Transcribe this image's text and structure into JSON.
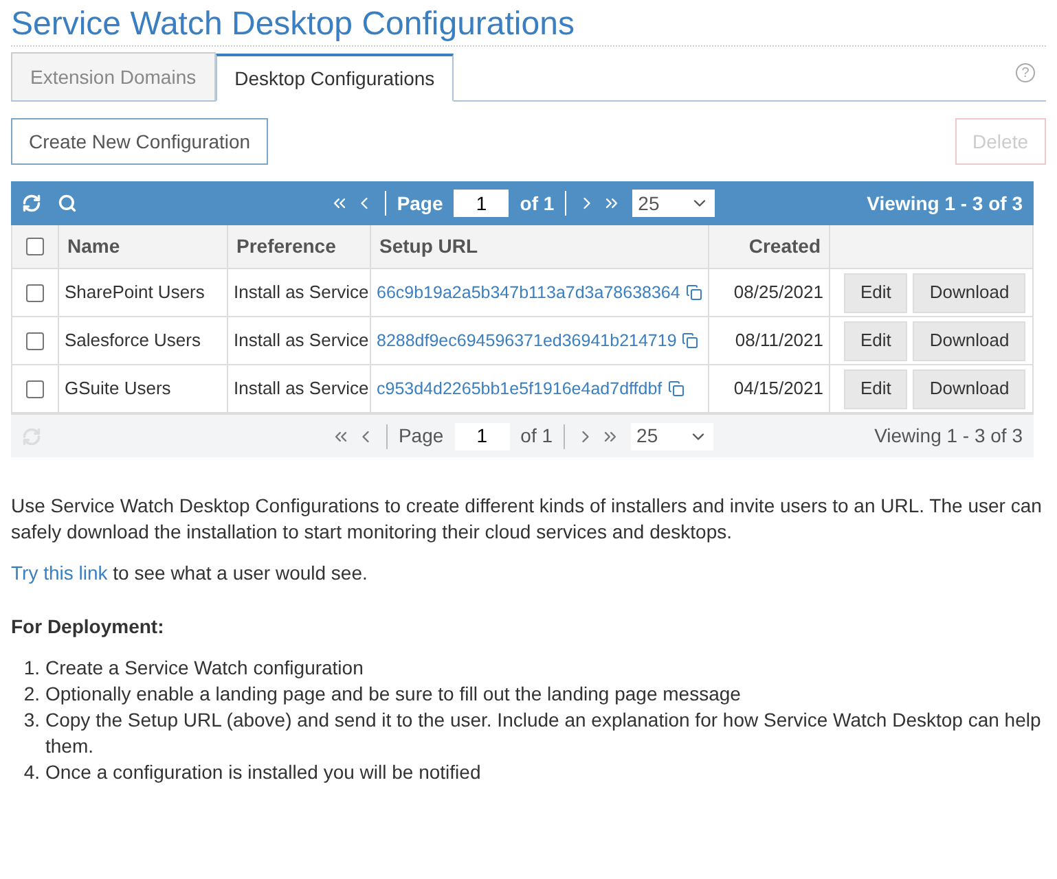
{
  "title": "Service Watch Desktop Configurations",
  "tabs": [
    {
      "label": "Extension Domains",
      "selected": false
    },
    {
      "label": "Desktop Configurations",
      "selected": true
    }
  ],
  "help_icon": "?",
  "buttons": {
    "create": {
      "label": "Create New Configuration",
      "disabled": false
    },
    "delete": {
      "label": "Delete",
      "disabled": true
    }
  },
  "pager_top": {
    "page_label": "Page",
    "page": "1",
    "of": "of 1",
    "page_size": "25",
    "viewing": "Viewing 1 - 3 of 3"
  },
  "table": {
    "columns": [
      "Name",
      "Preference",
      "Setup URL",
      "Created"
    ],
    "header_checked": false,
    "rows": [
      {
        "checked": false,
        "name": "SharePoint Users",
        "preference": "Install as Service",
        "url": "66c9b19a2a5b347b113a7d3a78638364",
        "created": "08/25/2021",
        "edit": "Edit",
        "download": "Download"
      },
      {
        "checked": false,
        "name": "Salesforce Users",
        "preference": "Install as Service",
        "url": "8288df9ec694596371ed36941b214719",
        "created": "08/11/2021",
        "edit": "Edit",
        "download": "Download"
      },
      {
        "checked": false,
        "name": "GSuite Users",
        "preference": "Install as Service",
        "url": "c953d4d2265bb1e5f1916e4ad7dffdbf",
        "created": "04/15/2021",
        "edit": "Edit",
        "download": "Download"
      }
    ]
  },
  "pager_bottom": {
    "page_label": "Page",
    "page": "1",
    "of": "of 1",
    "page_size": "25",
    "viewing": "Viewing 1 - 3 of 3"
  },
  "intro": "Use Service Watch Desktop Configurations to create different kinds of installers and invite users to an URL. The user can safely download the installation to start monitoring their cloud services and desktops.",
  "try_link": "Try this link",
  "try_rest": " to see what a user would see.",
  "deployment_heading": "For Deployment:",
  "steps": [
    {
      "number": "1.",
      "text": "Create a Service Watch configuration"
    },
    {
      "number": "2.",
      "text": "Optionally enable a landing page and be sure to fill out the landing page message"
    },
    {
      "number": "3.",
      "text": "Copy the Setup URL (above) and send it to the user. Include an explanation for how Service Watch Desktop can help them."
    },
    {
      "number": "4.",
      "text": "Once a configuration is installed you will be notified"
    }
  ]
}
